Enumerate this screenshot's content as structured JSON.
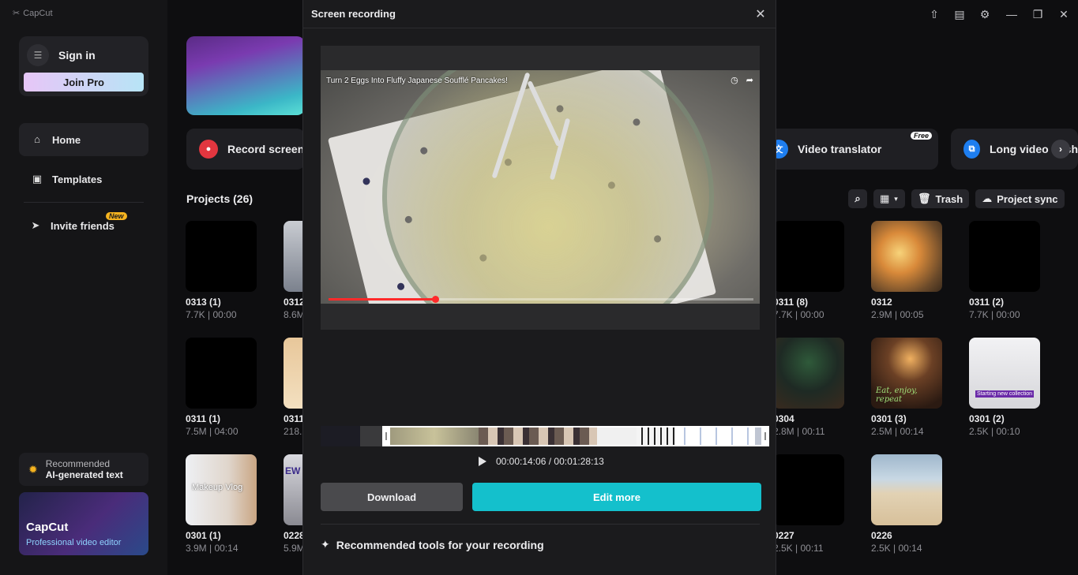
{
  "app": {
    "logo": "CapCut"
  },
  "window_controls": [
    "upload-icon",
    "feedback-icon",
    "settings-icon",
    "minimize-icon",
    "maximize-icon",
    "close-icon"
  ],
  "sidebar": {
    "sign_in": "Sign in",
    "join_pro": "Join Pro",
    "nav": [
      {
        "label": "Home",
        "icon": "home-icon",
        "active": true
      },
      {
        "label": "Templates",
        "icon": "templates-icon",
        "active": false
      },
      {
        "label": "Invite friends",
        "icon": "invite-icon",
        "badge": "New"
      }
    ],
    "recommended": {
      "top": "Recommended",
      "bottom": "AI-generated text"
    },
    "promo": {
      "title": "CapCut",
      "subtitle": "Professional video editor"
    }
  },
  "tools": [
    {
      "label": "Record screen",
      "icon": "record-icon",
      "color": "#e2363f"
    },
    {
      "label": "Video translator",
      "icon": "translate-icon",
      "color": "#1e7ef0",
      "badge": "Free"
    },
    {
      "label": "Long video to sh",
      "icon": "long-video-icon",
      "color": "#1e7ef0"
    }
  ],
  "projects": {
    "title": "Projects  (26)",
    "toolbar": {
      "trash": "Trash",
      "sync": "Project sync"
    },
    "items": [
      {
        "name": "0313 (1)",
        "meta": "7.7K | 00:00"
      },
      {
        "name": "0312",
        "meta": "8.6M"
      },
      {
        "name": "0311 (8)",
        "meta": "7.7K | 00:00"
      },
      {
        "name": "0312",
        "meta": "2.9M | 00:05"
      },
      {
        "name": "0311 (2)",
        "meta": "7.7K | 00:00"
      },
      {
        "name": "0311 (1)",
        "meta": "7.5M | 04:00"
      },
      {
        "name": "0311",
        "meta": "218."
      },
      {
        "name": "0304",
        "meta": "2.8M | 00:11"
      },
      {
        "name": "0301 (3)",
        "meta": "2.5M | 00:14"
      },
      {
        "name": "0301 (2)",
        "meta": "2.5K | 00:10"
      },
      {
        "name": "0301 (1)",
        "meta": "3.9M | 00:14"
      },
      {
        "name": "0228",
        "meta": "5.9M"
      },
      {
        "name": "0227",
        "meta": "2.5K | 00:11"
      },
      {
        "name": "0226",
        "meta": "2.5K | 00:14"
      }
    ],
    "thumb_texts": {
      "makeup": "Makeup Vlog",
      "eat": "Eat, enjoy, repeat",
      "collection": "Starting new collection",
      "ew": "EW"
    }
  },
  "modal": {
    "title": "Screen recording",
    "video_title": "Turn 2 Eggs Into Fluffy Japanese Soufflé Pancakes!",
    "playback_fraction": 0.25,
    "time": "00:00:14:06 / 00:01:28:13",
    "download": "Download",
    "edit_more": "Edit more",
    "recommended_tools": "Recommended tools for your recording"
  }
}
